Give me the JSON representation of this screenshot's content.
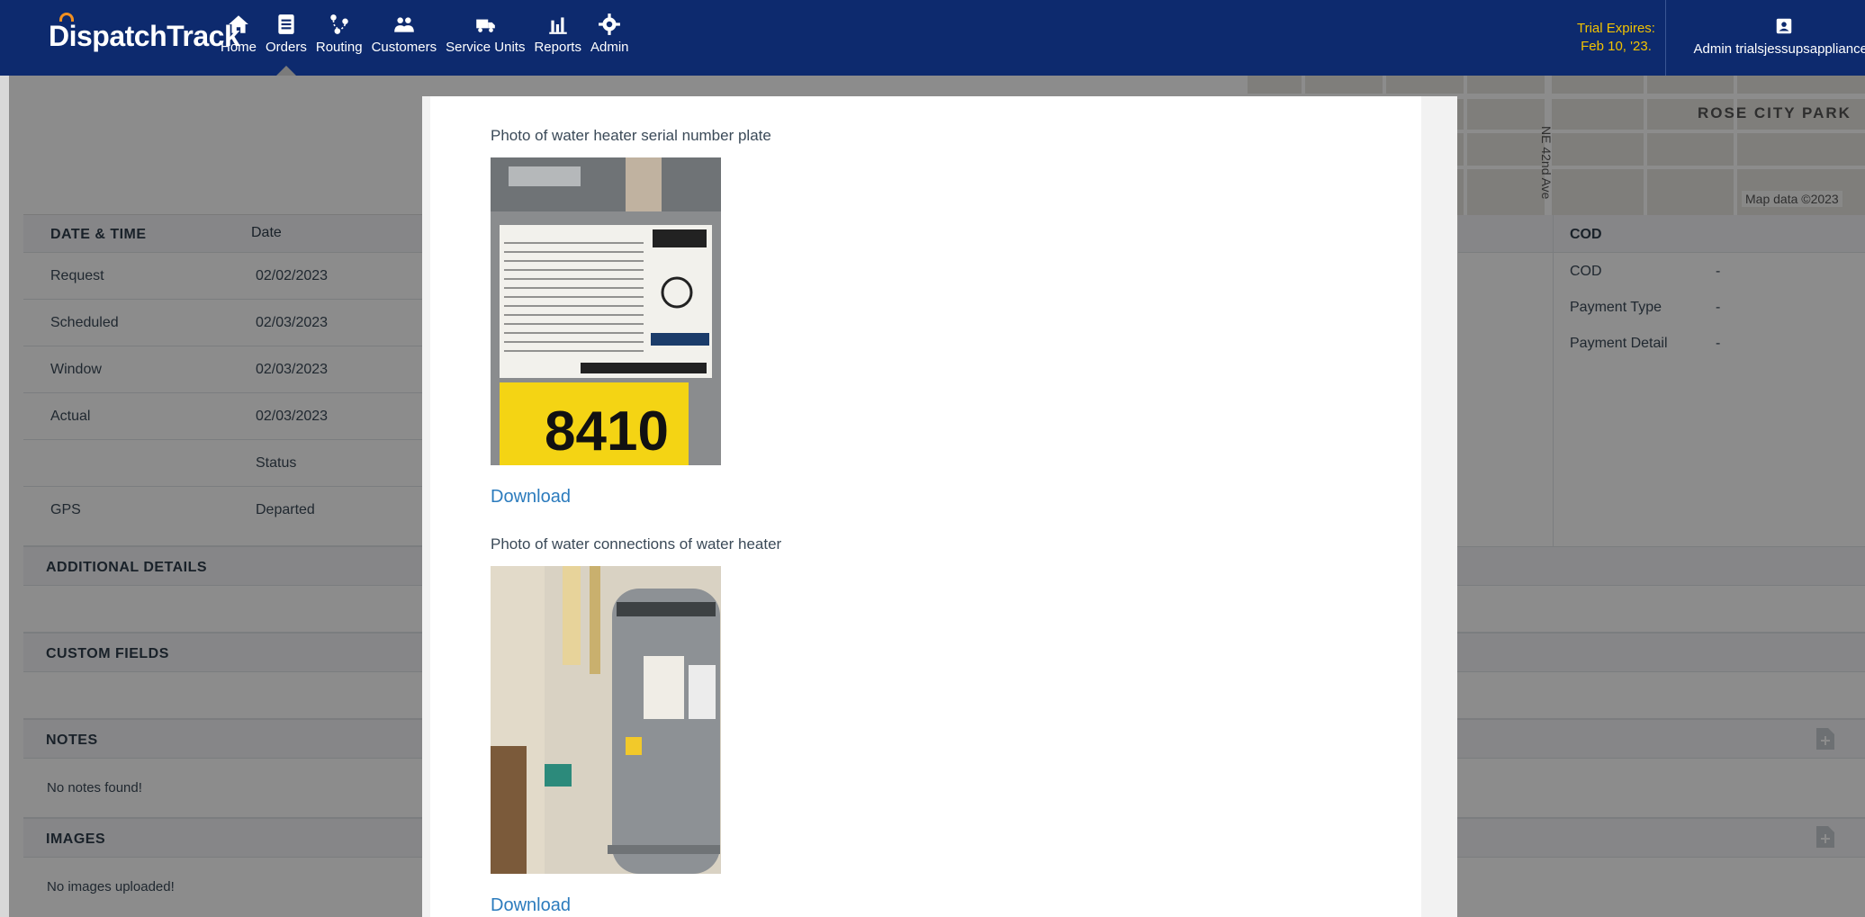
{
  "app": {
    "logo": "DispatchTrack",
    "nav": [
      {
        "label": "Home",
        "icon": "home-icon"
      },
      {
        "label": "Orders",
        "icon": "orders-icon",
        "active": true
      },
      {
        "label": "Routing",
        "icon": "routing-icon"
      },
      {
        "label": "Customers",
        "icon": "customers-icon"
      },
      {
        "label": "Service Units",
        "icon": "truck-icon"
      },
      {
        "label": "Reports",
        "icon": "reports-icon"
      },
      {
        "label": "Admin",
        "icon": "gear-icon"
      }
    ],
    "trial": {
      "line1": "Trial Expires:",
      "line2": "Feb 10, '23."
    },
    "user": "Admin trialsjessupsappliances"
  },
  "map": {
    "area_label": "ROSE CITY PARK",
    "street_label": "NE 42nd Ave",
    "credit": "Map data ©2023"
  },
  "date_time": {
    "title": "DATE & TIME",
    "col_header": "Date",
    "rows": [
      {
        "label": "Request",
        "value": "02/02/2023"
      },
      {
        "label": "Scheduled",
        "value": "02/03/2023"
      },
      {
        "label": "Window",
        "value": "02/03/2023"
      },
      {
        "label": "Actual",
        "value": "02/03/2023"
      },
      {
        "label": "",
        "value": "Status"
      },
      {
        "label": "GPS",
        "value": "Departed"
      }
    ]
  },
  "cod": {
    "title": "COD",
    "rows": [
      {
        "label": "COD",
        "value": "-"
      },
      {
        "label": "Payment Type",
        "value": "-"
      },
      {
        "label": "Payment Detail",
        "value": "-"
      }
    ]
  },
  "sections": {
    "additional_details": "ADDITIONAL DETAILS",
    "custom_fields": "CUSTOM FIELDS",
    "notes": "NOTES",
    "notes_empty": "No notes found!",
    "images": "IMAGES",
    "images_empty": "No images uploaded!"
  },
  "modal": {
    "photos": [
      {
        "label": "Photo of water heater serial number plate",
        "download": "Download",
        "plate_number": "8410"
      },
      {
        "label": "Photo of water connections of water heater",
        "download": "Download"
      }
    ]
  },
  "colors": {
    "nav_bg": "#0d2a6e",
    "trial": "#f2c200",
    "link": "#2b7bbd",
    "accent_orange": "#f29021"
  }
}
